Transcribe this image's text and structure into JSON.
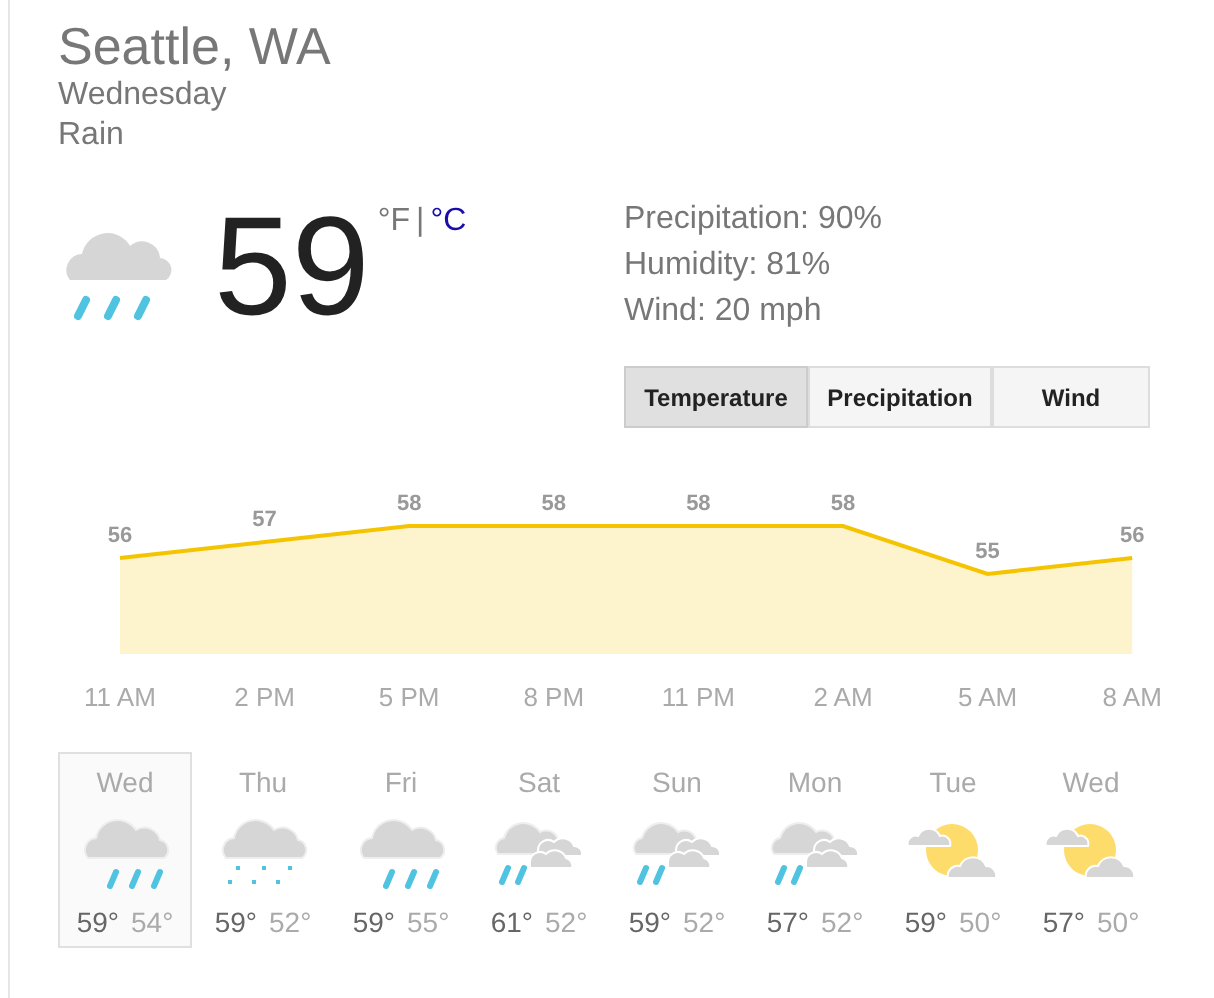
{
  "location": "Seattle, WA",
  "day": "Wednesday",
  "condition": "Rain",
  "current": {
    "kind": "rain",
    "temperature": "59",
    "unit_f": "°F",
    "separator": "|",
    "unit_c": "°C"
  },
  "details": [
    "Precipitation: 90%",
    "Humidity: 81%",
    "Wind: 20 mph"
  ],
  "tabs": [
    {
      "label": "Temperature",
      "selected": true
    },
    {
      "label": "Precipitation",
      "selected": false
    },
    {
      "label": "Wind",
      "selected": false
    }
  ],
  "chart_data": {
    "type": "area",
    "categories": [
      "11 AM",
      "2 PM",
      "5 PM",
      "8 PM",
      "11 PM",
      "2 AM",
      "5 AM",
      "8 AM"
    ],
    "series": [
      {
        "color": "#f5c400",
        "values": [
          56,
          57,
          58,
          58,
          58,
          58,
          55,
          56
        ]
      }
    ],
    "data_labels": true
  },
  "forecast": [
    {
      "day": "Wed",
      "kind": "rain",
      "high": "59°",
      "low": "54°",
      "selected": true
    },
    {
      "day": "Thu",
      "kind": "snow",
      "high": "59°",
      "low": "52°",
      "selected": false
    },
    {
      "day": "Fri",
      "kind": "rain",
      "high": "59°",
      "low": "55°",
      "selected": false
    },
    {
      "day": "Sat",
      "kind": "showers",
      "high": "61°",
      "low": "52°",
      "selected": false
    },
    {
      "day": "Sun",
      "kind": "showers",
      "high": "59°",
      "low": "52°",
      "selected": false
    },
    {
      "day": "Mon",
      "kind": "showers",
      "high": "57°",
      "low": "52°",
      "selected": false
    },
    {
      "day": "Tue",
      "kind": "sun",
      "high": "59°",
      "low": "50°",
      "selected": false
    },
    {
      "day": "Wed",
      "kind": "sun",
      "high": "57°",
      "low": "50°",
      "selected": false
    }
  ]
}
